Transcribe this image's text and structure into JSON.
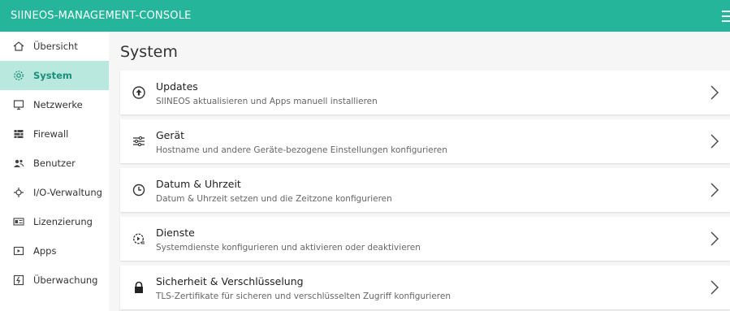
{
  "app": {
    "title": "SIINEOS-MANAGEMENT-CONSOLE",
    "menu_icon": "hamburger-menu-icon"
  },
  "colors": {
    "header": "#24b59a",
    "active_bg": "#b9e8df",
    "active_text": "#1a8f79"
  },
  "sidebar": {
    "items": [
      {
        "label": "Übersicht",
        "icon": "home-icon"
      },
      {
        "label": "System",
        "icon": "gear-icon",
        "active": true
      },
      {
        "label": "Netzwerke",
        "icon": "monitor-icon"
      },
      {
        "label": "Firewall",
        "icon": "firewall-icon"
      },
      {
        "label": "Benutzer",
        "icon": "users-icon"
      },
      {
        "label": "I/O-Verwaltung",
        "icon": "io-icon"
      },
      {
        "label": "Lizenzierung",
        "icon": "license-icon"
      },
      {
        "label": "Apps",
        "icon": "apps-icon"
      },
      {
        "label": "Überwachung",
        "icon": "monitoring-icon"
      }
    ]
  },
  "main": {
    "title": "System",
    "cards": [
      {
        "title": "Updates",
        "desc": "SIINEOS aktualisieren und Apps manuell installieren",
        "icon": "upload-icon"
      },
      {
        "title": "Gerät",
        "desc": "Hostname und andere Geräte-bezogene Einstellungen konfigurieren",
        "icon": "sliders-icon"
      },
      {
        "title": "Datum & Uhrzeit",
        "desc": "Datum & Uhrzeit setzen und die Zeitzone konfigurieren",
        "icon": "clock-icon"
      },
      {
        "title": "Dienste",
        "desc": "Systemdienste konfigurieren und aktivieren oder deaktivieren",
        "icon": "services-icon"
      },
      {
        "title": "Sicherheit & Verschlüsselung",
        "desc": "TLS-Zertifikate für sicheren und verschlüsselten Zugriff konfigurieren",
        "icon": "lock-icon"
      }
    ]
  }
}
